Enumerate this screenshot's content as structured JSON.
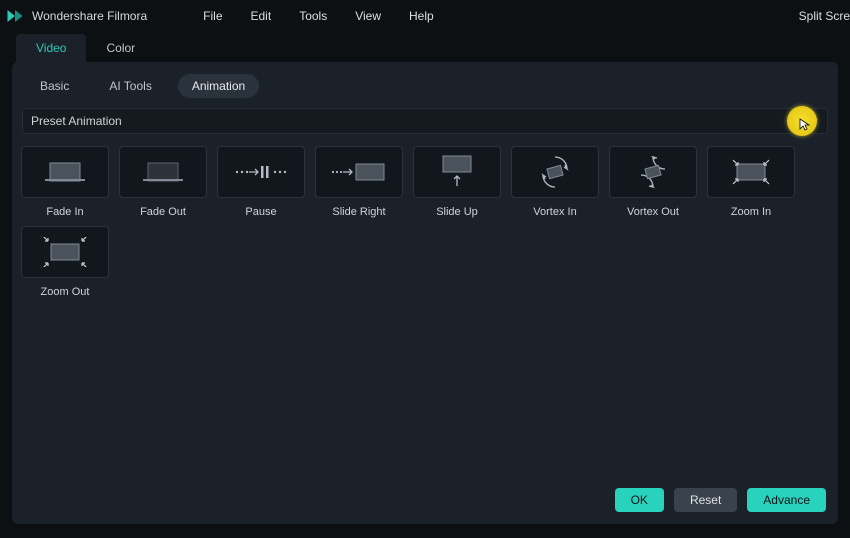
{
  "app": {
    "title": "Wondershare Filmora"
  },
  "menu": {
    "file": "File",
    "edit": "Edit",
    "tools": "Tools",
    "view": "View",
    "help": "Help",
    "split": "Split Scre"
  },
  "main_tabs": {
    "video": "Video",
    "color": "Color"
  },
  "sub_tabs": {
    "basic": "Basic",
    "ai": "AI Tools",
    "animation": "Animation"
  },
  "section": {
    "preset": "Preset Animation"
  },
  "presets": {
    "fade_in": "Fade In",
    "fade_out": "Fade Out",
    "pause": "Pause",
    "slide_right": "Slide Right",
    "slide_up": "Slide Up",
    "vortex_in": "Vortex In",
    "vortex_out": "Vortex Out",
    "zoom_in": "Zoom In",
    "zoom_out": "Zoom Out"
  },
  "footer": {
    "ok": "OK",
    "reset": "Reset",
    "advance": "Advance"
  },
  "colors": {
    "accent": "#29d2bd"
  }
}
